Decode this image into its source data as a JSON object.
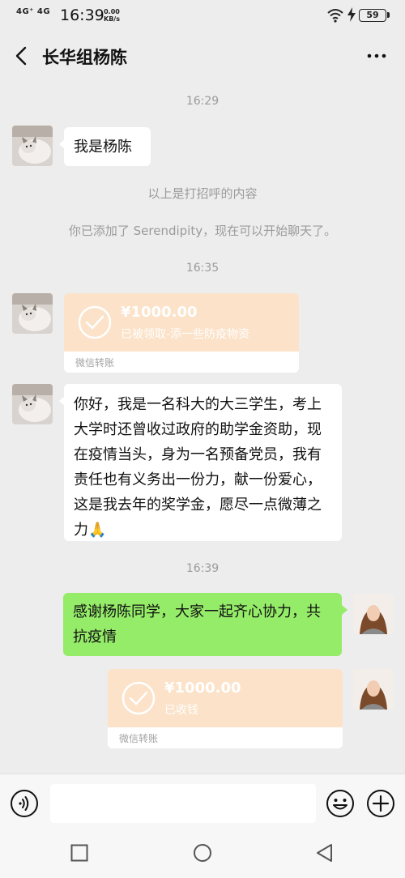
{
  "status_bar": {
    "signal": "4G⁺ 4G",
    "time": "16:39",
    "speed_value": "0.00",
    "speed_unit": "KB/s",
    "battery": "59"
  },
  "header": {
    "title": "长华组杨陈",
    "back_icon": "chevron-left-icon",
    "more_icon": "ellipsis-icon"
  },
  "messages": {
    "ts1": "16:29",
    "m1_text": "我是杨陈",
    "sys1": "以上是打招呼的内容",
    "sys2": "你已添加了 Serendipity，现在可以开始聊天了。",
    "ts2": "16:35",
    "transfer1": {
      "amount": "¥1000.00",
      "note": "已被领取-添一些防疫物资",
      "label": "微信转账"
    },
    "m2_text": "你好，我是一名科大的大三学生，考上大学时还曾收过政府的助学金资助，现在疫情当头，身为一名预备党员，我有责任也有义务出一份力，献一份爱心，这是我去年的奖学金，愿尽一点微薄之力",
    "m2_emoji": "🙏",
    "ts3": "16:39",
    "m3_text": "感谢杨陈同学，大家一起齐心协力，共抗疫情",
    "transfer2": {
      "amount": "¥1000.00",
      "note": "已收钱",
      "label": "微信转账"
    }
  },
  "input_bar": {
    "value": "",
    "placeholder": "",
    "voice_icon": "voice-icon",
    "emoji_icon": "emoji-icon",
    "plus_icon": "plus-icon"
  },
  "colors": {
    "background": "#ededed",
    "sent_bubble": "#95ec69",
    "received_bubble": "#ffffff",
    "transfer_card": "#fbe2c8"
  }
}
